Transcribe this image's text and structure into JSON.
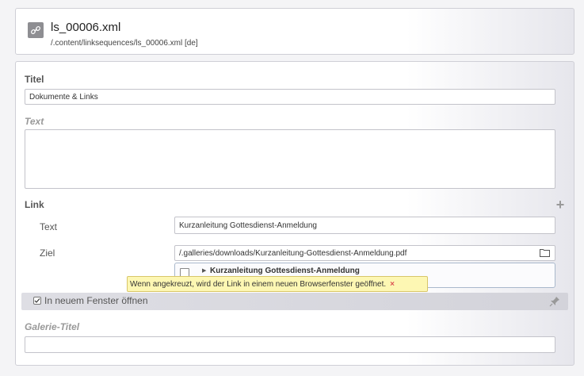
{
  "header": {
    "title": "ls_00006.xml",
    "path": "/.content/linksequences/ls_00006.xml [de]"
  },
  "form": {
    "titel": {
      "label": "Titel",
      "value": "Dokumente & Links"
    },
    "text": {
      "label": "Text",
      "value": ""
    },
    "link": {
      "label": "Link",
      "text_label": "Text",
      "text_value": "Kurzanleitung Gottesdienst-Anmeldung",
      "ziel_label": "Ziel",
      "ziel_value": "/.galleries/downloads/Kurzanleitung-Gottesdienst-Anmeldung.pdf",
      "suggestion": "Kurzanleitung Gottesdienst-Anmeldung",
      "tooltip": "Wenn angekreuzt, wird der Link in einem neuen Browserfenster geöffnet.",
      "tooltip_close": "×",
      "new_window_label": "In neuem Fenster öffnen",
      "new_window_checked": true
    },
    "galerie_titel": {
      "label": "Galerie-Titel",
      "value": ""
    }
  },
  "icons": {
    "file": "link-icon",
    "add": "plus-icon",
    "browse": "folder-icon",
    "pin": "pin-icon"
  }
}
